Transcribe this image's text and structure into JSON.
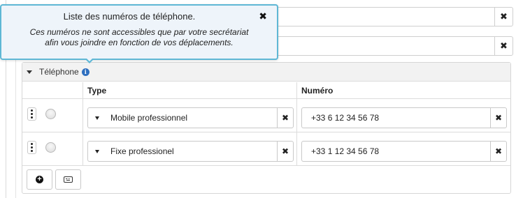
{
  "popover": {
    "title": "Liste des numéros de téléphone.",
    "close_label": "✖",
    "body_line1": "Ces numéros ne sont accessibles que par votre secrétariat",
    "body_line2": "afin vous joindre en fonction de vos déplacements."
  },
  "background_fields": [
    {
      "clear_label": "✖"
    },
    {
      "clear_label": "✖"
    }
  ],
  "panel": {
    "title": "Téléphone",
    "info_icon": "info-circle-icon",
    "columns": {
      "type": "Type",
      "number": "Numéro"
    },
    "rows": [
      {
        "type": "Mobile professionnel",
        "number": "+33 6 12 34 56 78",
        "clear_label": "✖"
      },
      {
        "type": "Fixe professionel",
        "number": "+33 1 12 34 56 78",
        "clear_label": "✖"
      }
    ],
    "footer": {
      "add_icon": "plus-circle-icon",
      "add_symbol": "+",
      "keyboard_icon": "keyboard-icon"
    }
  },
  "colors": {
    "popover_border": "#5eb7d5",
    "popover_bg": "#eef4fa",
    "info_icon": "#2e6fbf"
  }
}
